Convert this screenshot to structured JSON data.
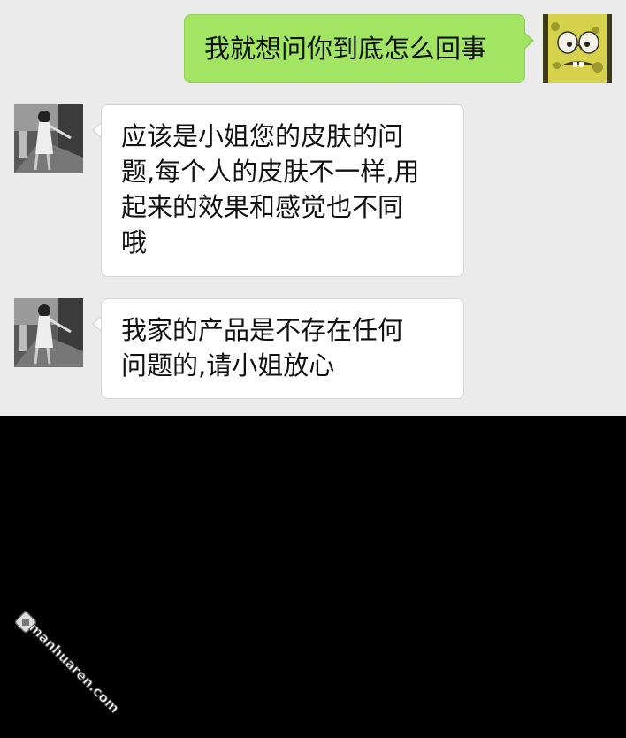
{
  "messages": [
    {
      "side": "right",
      "avatar": "spongebob-avatar-icon",
      "text": "我就想问你到底怎么回事"
    },
    {
      "side": "left",
      "avatar": "contact-avatar-icon",
      "lines": [
        "应该是小姐您的皮肤的问",
        "题,每个人的皮肤不一样,用",
        "起来的效果和感觉也不同",
        "哦"
      ]
    },
    {
      "side": "left",
      "avatar": "contact-avatar-icon",
      "lines": [
        "我家的产品是不存在任何",
        "问题的,请小姐放心"
      ]
    }
  ],
  "watermark": {
    "text": "manhuaren.com"
  },
  "colors": {
    "chat_background": "#ebebeb",
    "sent_bubble": "#a2e563",
    "received_bubble": "#ffffff",
    "lower_background": "#000000"
  }
}
